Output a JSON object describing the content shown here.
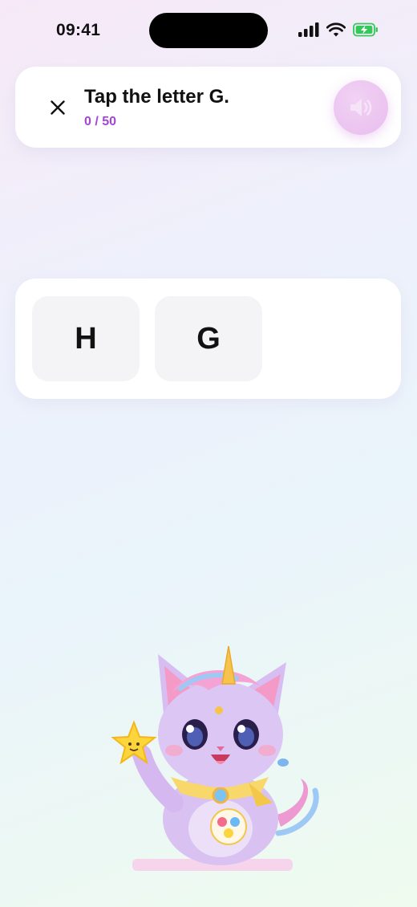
{
  "status_bar": {
    "time": "09:41",
    "icons": [
      "cellular-signal-icon",
      "wifi-icon",
      "battery-charging-icon"
    ]
  },
  "header": {
    "close_icon": "close-icon",
    "prompt": "Tap the letter G.",
    "progress": "0 / 50",
    "progress_value": {
      "current": 0,
      "total": 50
    },
    "audio_icon": "speaker-icon"
  },
  "choices": [
    {
      "letter": "H"
    },
    {
      "letter": "G"
    }
  ],
  "colors": {
    "accent_purple": "#a544d6",
    "audio_button": "#ecc6f0",
    "card": "#ffffff",
    "tile": "#f4f4f6",
    "battery_green": "#34c759"
  },
  "mascot": {
    "image": "unicorn-cat-mascot-with-star"
  }
}
